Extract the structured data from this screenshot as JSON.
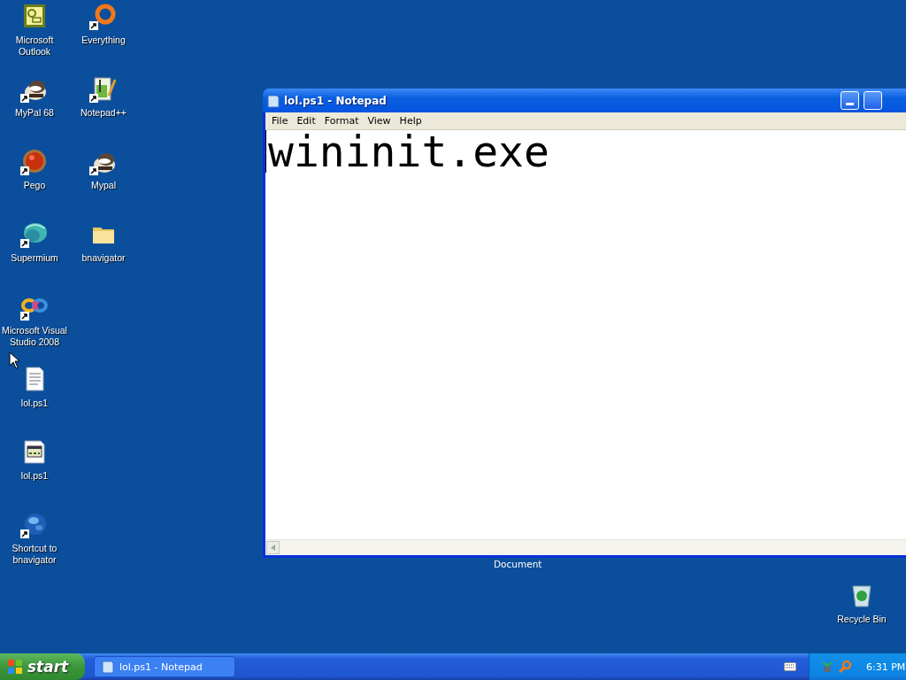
{
  "desktop_icons": [
    {
      "label": "Microsoft Outlook",
      "kind": "outlook",
      "shortcut": false
    },
    {
      "label": "MyPal 68",
      "kind": "raccoon",
      "shortcut": true
    },
    {
      "label": "Pego",
      "kind": "red-ball",
      "shortcut": true
    },
    {
      "label": "Supermium",
      "kind": "teal-globe",
      "shortcut": true
    },
    {
      "label": "Microsoft Visual Studio 2008",
      "kind": "infinity",
      "shortcut": true
    },
    {
      "label": "lol.ps1",
      "kind": "text-file",
      "shortcut": false
    },
    {
      "label": "lol.ps1",
      "kind": "script-file",
      "shortcut": false
    },
    {
      "label": "Shortcut to bnavigator",
      "kind": "blue-globe",
      "shortcut": true
    },
    {
      "label": "Everything",
      "kind": "ring",
      "shortcut": true
    },
    {
      "label": "Notepad++",
      "kind": "notepadpp",
      "shortcut": true
    },
    {
      "label": "Mypal",
      "kind": "raccoon",
      "shortcut": true
    },
    {
      "label": "bnavigator",
      "kind": "folder",
      "shortcut": false
    }
  ],
  "hidden_icon_label": "Document",
  "recycle_bin": {
    "label": "Recycle Bin"
  },
  "window": {
    "title": "lol.ps1 - Notepad",
    "active": true,
    "menu": [
      "File",
      "Edit",
      "Format",
      "View",
      "Help"
    ],
    "content": "wininit.exe"
  },
  "taskbar": {
    "start": "start",
    "tasks": [
      {
        "label": "lol.ps1 - Notepad",
        "selected": false
      }
    ],
    "clock": "6:31 PM"
  }
}
